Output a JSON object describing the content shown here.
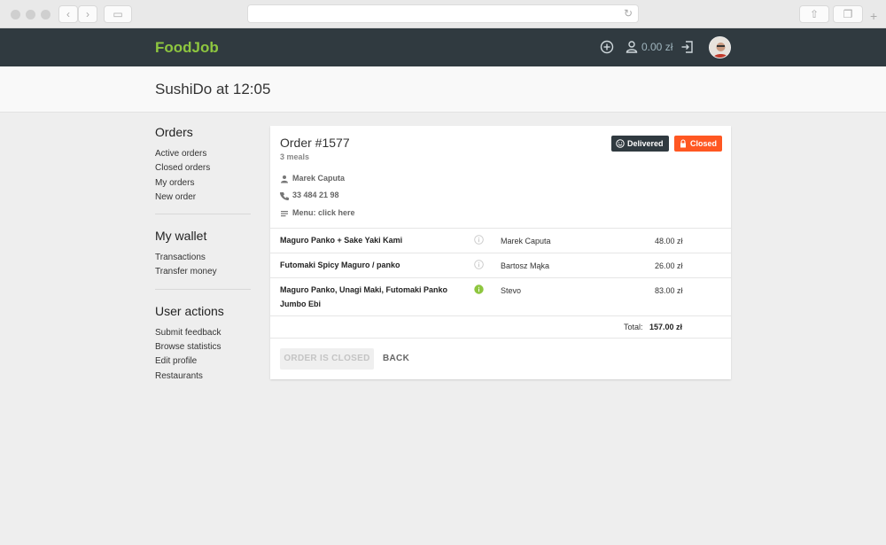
{
  "app": {
    "brand": "FoodJob",
    "balance": "0.00 zł",
    "page_title": "SushiDo at 12:05"
  },
  "sidebar": {
    "sections": [
      {
        "title": "Orders",
        "items": [
          "Active orders",
          "Closed orders",
          "My orders",
          "New order"
        ]
      },
      {
        "title": "My wallet",
        "items": [
          "Transactions",
          "Transfer money"
        ]
      },
      {
        "title": "User actions",
        "items": [
          "Submit feedback",
          "Browse statistics",
          "Edit profile",
          "Restaurants"
        ]
      }
    ]
  },
  "order": {
    "title": "Order #1577",
    "meals_count": "3 meals",
    "badges": {
      "delivered": "Delivered",
      "closed": "Closed"
    },
    "owner": "Marek Caputa",
    "phone": "33 484 21 98",
    "menu": "Menu: click here",
    "items": [
      {
        "meal": "Maguro Panko + Sake Yaki Kami",
        "person": "Marek Caputa",
        "price": "48.00 zł",
        "info_active": false
      },
      {
        "meal": "Futomaki Spicy Maguro / panko",
        "person": "Bartosz Mąka",
        "price": "26.00 zł",
        "info_active": false
      },
      {
        "meal": "Maguro Panko, Unagi Maki, Futomaki Panko Jumbo Ebi",
        "person": "Stevo",
        "price": "83.00 zł",
        "info_active": true
      }
    ],
    "total_label": "Total:",
    "total_value": "157.00 zł",
    "closed_button": "ORDER IS CLOSED",
    "back_button": "BACK"
  },
  "colors": {
    "brand": "#8ec63f",
    "header_bg": "#303a40",
    "delivered_badge": "#303a40",
    "closed_badge": "#ff5722",
    "info_active": "#8ec63f"
  }
}
